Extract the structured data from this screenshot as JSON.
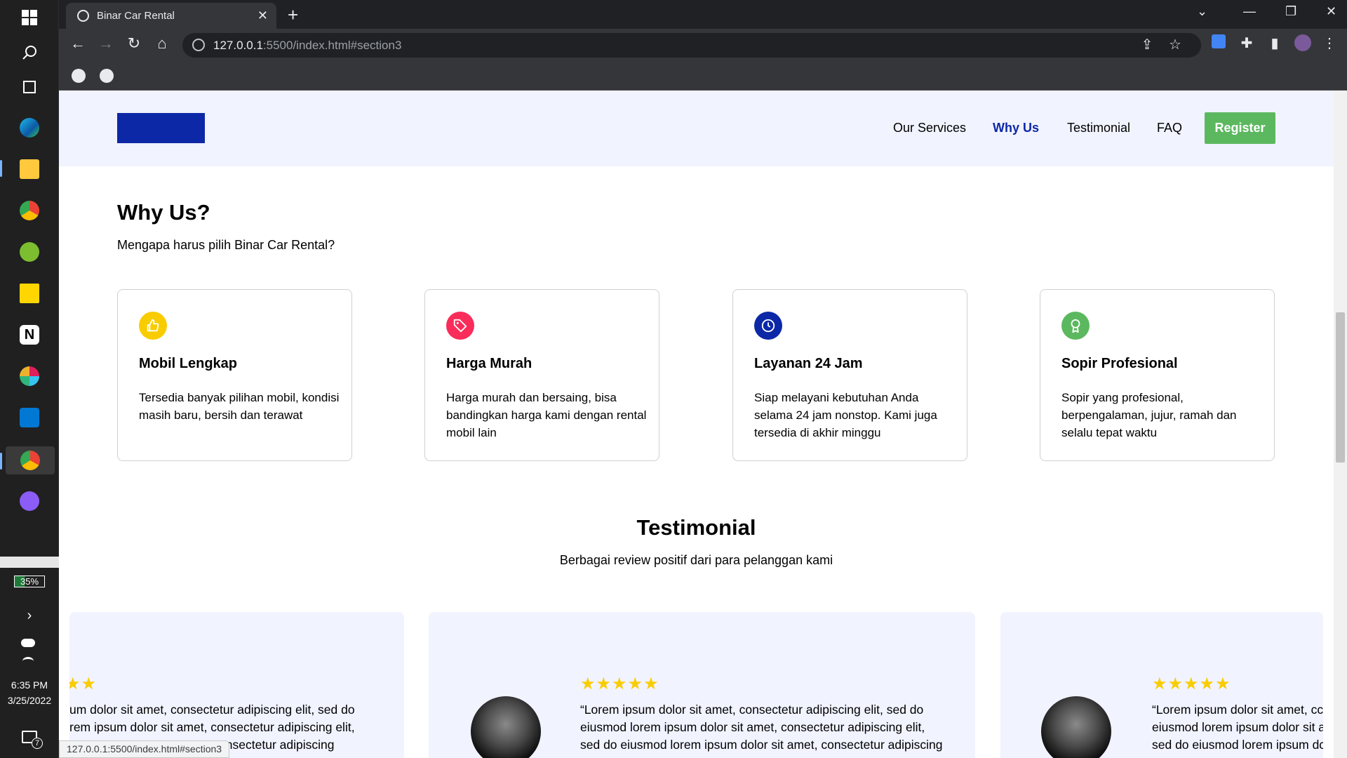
{
  "taskbar": {
    "battery": "35%",
    "time": "6:35 PM",
    "date": "3/25/2022",
    "notifications": "7"
  },
  "browser": {
    "tab_title": "Binar Car Rental",
    "url_host": "127.0.0.1",
    "url_rest": ":5500/index.html#section3",
    "status_url": "127.0.0.1:5500/index.html#section3"
  },
  "header": {
    "nav": [
      "Our Services",
      "Why Us",
      "Testimonial",
      "FAQ"
    ],
    "register": "Register",
    "accent": "#0d28a6",
    "register_color": "#5cb85f"
  },
  "why": {
    "title": "Why Us?",
    "subtitle": "Mengapa harus pilih Binar Car Rental?",
    "cards": [
      {
        "icon": "thumbs-up-icon",
        "color": "#f9cc00",
        "title": "Mobil Lengkap",
        "desc": "Tersedia banyak pilihan mobil, kondisi masih baru, bersih dan terawat"
      },
      {
        "icon": "price-tag-icon",
        "color": "#fa2c5a",
        "title": "Harga Murah",
        "desc": "Harga murah dan bersaing, bisa bandingkan harga kami dengan rental mobil lain"
      },
      {
        "icon": "clock-icon",
        "color": "#0d28a6",
        "title": "Layanan 24 Jam",
        "desc": "Siap melayani kebutuhan Anda selama 24 jam nonstop. Kami juga tersedia di akhir minggu"
      },
      {
        "icon": "award-icon",
        "color": "#5cb85f",
        "title": "Sopir Profesional",
        "desc": "Sopir yang profesional, berpengalaman, jujur, ramah dan selalu tepat waktu"
      }
    ]
  },
  "testimonial": {
    "title": "Testimonial",
    "subtitle": "Berbagai review positif dari para pelanggan kami",
    "left": {
      "stars": "★★",
      "lines": [
        "um dolor sit amet, consectetur adipiscing elit, sed do",
        "rem ipsum dolor sit amet, consectetur adipiscing elit,",
        "et, consectetur adipiscing"
      ]
    },
    "center": {
      "stars": "★★★★★",
      "lines": [
        "“Lorem ipsum dolor sit amet, consectetur adipiscing elit, sed do",
        "eiusmod lorem ipsum dolor sit amet, consectetur adipiscing elit,",
        "sed do eiusmod lorem ipsum dolor sit amet, consectetur adipiscing"
      ]
    },
    "right": {
      "stars": "★★★★★",
      "lines": [
        "“Lorem ipsum dolor sit amet, cc",
        "eiusmod lorem ipsum dolor sit a",
        "sed do eiusmod lorem ipsum dc"
      ]
    }
  }
}
